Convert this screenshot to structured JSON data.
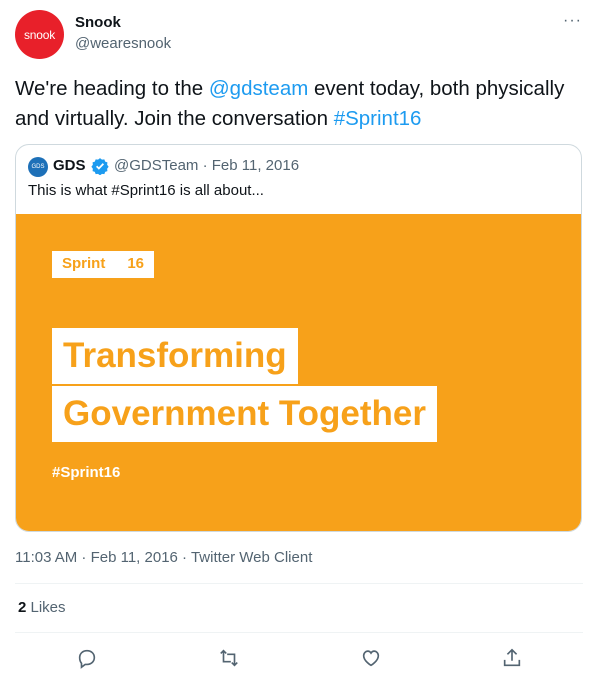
{
  "author": {
    "avatar_text": "snook",
    "name": "Snook",
    "handle": "@wearesnook"
  },
  "more_label": "···",
  "tweet": {
    "text_1": "We're heading to the ",
    "mention": "@gdsteam",
    "text_2": " event today, both physically and virtually. Join the conversation ",
    "hashtag": "#Sprint16"
  },
  "quoted": {
    "avatar_text": "GDS",
    "name": "GDS",
    "meta": "@GDSTeam · Feb 11, 2016",
    "text": "This is what #Sprint16 is all about...",
    "media": {
      "sprint_word": "Sprint",
      "sprint_number": "16",
      "line_1": "Transforming",
      "line_2": "Government Together",
      "hashtag": "#Sprint16"
    }
  },
  "timestamp": "11:03 AM · Feb 11, 2016 · Twitter Web Client",
  "likes": {
    "count": "2",
    "label": " Likes"
  },
  "actions": [
    "reply-icon",
    "retweet-icon",
    "like-icon",
    "share-icon"
  ],
  "colors": {
    "accent": "#1d9bf0",
    "media_bg": "#f7a11a",
    "avatar_bg": "#e8202a"
  }
}
